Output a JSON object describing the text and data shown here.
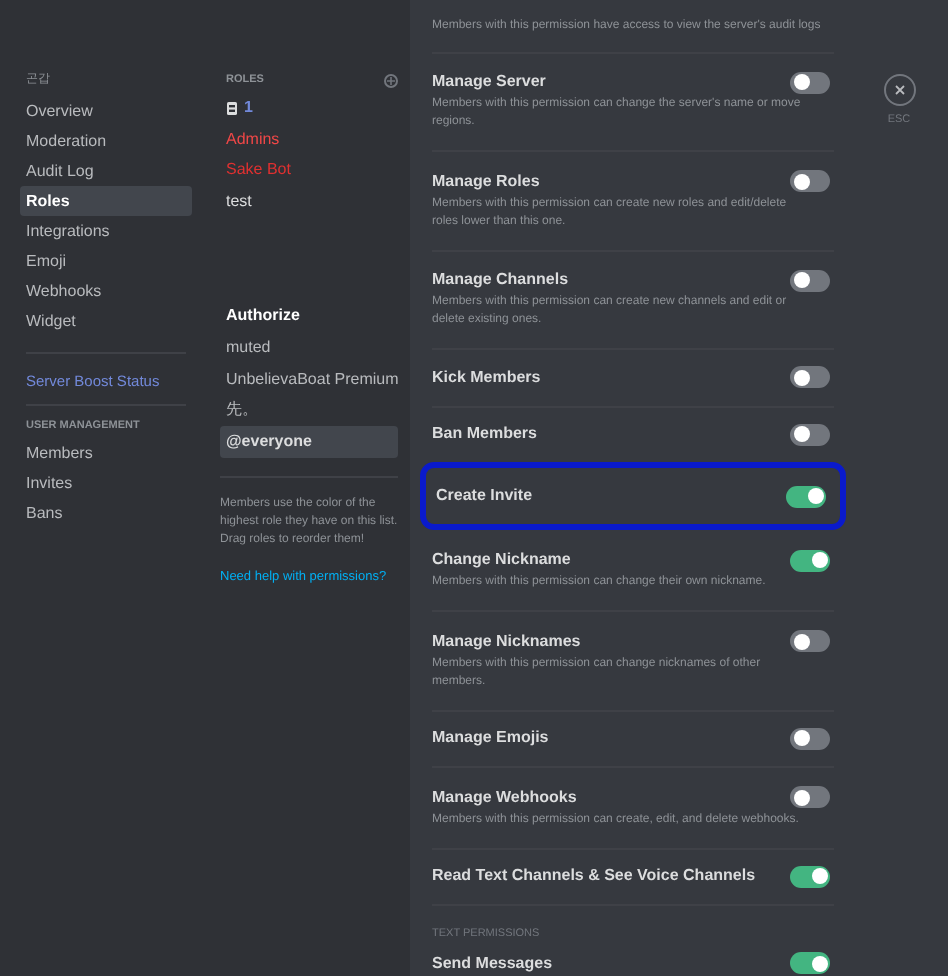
{
  "sidebar": {
    "header": "곤갑",
    "items": [
      {
        "label": "Overview",
        "selected": false
      },
      {
        "label": "Moderation",
        "selected": false
      },
      {
        "label": "Audit Log",
        "selected": false
      },
      {
        "label": "Roles",
        "selected": true
      },
      {
        "label": "Integrations",
        "selected": false
      },
      {
        "label": "Emoji",
        "selected": false
      },
      {
        "label": "Webhooks",
        "selected": false
      },
      {
        "label": "Widget",
        "selected": false
      }
    ],
    "boost_link": "Server Boost Status",
    "section": "USER MANAGEMENT",
    "section_items": [
      {
        "label": "Members",
        "selected": false
      },
      {
        "label": "Invites",
        "selected": false
      },
      {
        "label": "Bans",
        "selected": false
      }
    ]
  },
  "roles": {
    "header": "ROLES",
    "items": [
      {
        "label": "1",
        "kind": "icon",
        "color": "#7289da",
        "selected": false
      },
      {
        "label": "Admins",
        "kind": "plain",
        "color": "#f04747",
        "selected": false
      },
      {
        "label": "Sake Bot",
        "kind": "plain",
        "color": "#e03030",
        "selected": false
      },
      {
        "label": "test",
        "kind": "plain",
        "color": "#dcddde",
        "selected": false
      },
      {
        "label": "Authorize",
        "kind": "gap",
        "color": "#ffffff",
        "selected": false
      },
      {
        "label": "muted",
        "kind": "plain",
        "color": "#b9bbbe",
        "selected": false
      },
      {
        "label": "UnbelievaBoat Premium",
        "kind": "plain",
        "color": "#b9bbbe",
        "selected": false
      },
      {
        "label": "先。",
        "kind": "plain",
        "color": "#b9bbbe",
        "selected": false
      },
      {
        "label": "@everyone",
        "kind": "plain",
        "color": "#dcddde",
        "selected": true
      }
    ],
    "hint": "Members use the color of the highest role they have on this list. Drag roles to reorder them!",
    "help_link": "Need help with permissions?"
  },
  "permissions": {
    "top_description": "Members with this permission have access to view the server's audit logs",
    "items": [
      {
        "title": "Manage Server",
        "description": "Members with this permission can change the server's name or move regions.",
        "on": false,
        "circled": false
      },
      {
        "title": "Manage Roles",
        "description": "Members with this permission can create new roles and edit/delete roles lower than this one.",
        "on": false,
        "circled": false
      },
      {
        "title": "Manage Channels",
        "description": "Members with this permission can create new channels and edit or delete existing ones.",
        "on": false,
        "circled": false
      },
      {
        "title": "Kick Members",
        "on": false,
        "circled": false
      },
      {
        "title": "Ban Members",
        "on": false,
        "circled": false
      },
      {
        "title": "Create Invite",
        "on": true,
        "circled": true
      },
      {
        "title": "Change Nickname",
        "description": "Members with this permission can change their own nickname.",
        "on": true,
        "circled": false
      },
      {
        "title": "Manage Nicknames",
        "description": "Members with this permission can change nicknames of other members.",
        "on": false,
        "circled": false
      },
      {
        "title": "Manage Emojis",
        "on": false,
        "circled": false
      },
      {
        "title": "Manage Webhooks",
        "description": "Members with this permission can create, edit, and delete webhooks.",
        "on": false,
        "circled": false
      },
      {
        "title": "Read Text Channels & See Voice Channels",
        "on": true,
        "circled": false
      }
    ],
    "section": "TEXT PERMISSIONS",
    "next_item": {
      "title": "Send Messages",
      "on": true
    }
  },
  "close": {
    "label": "ESC"
  }
}
